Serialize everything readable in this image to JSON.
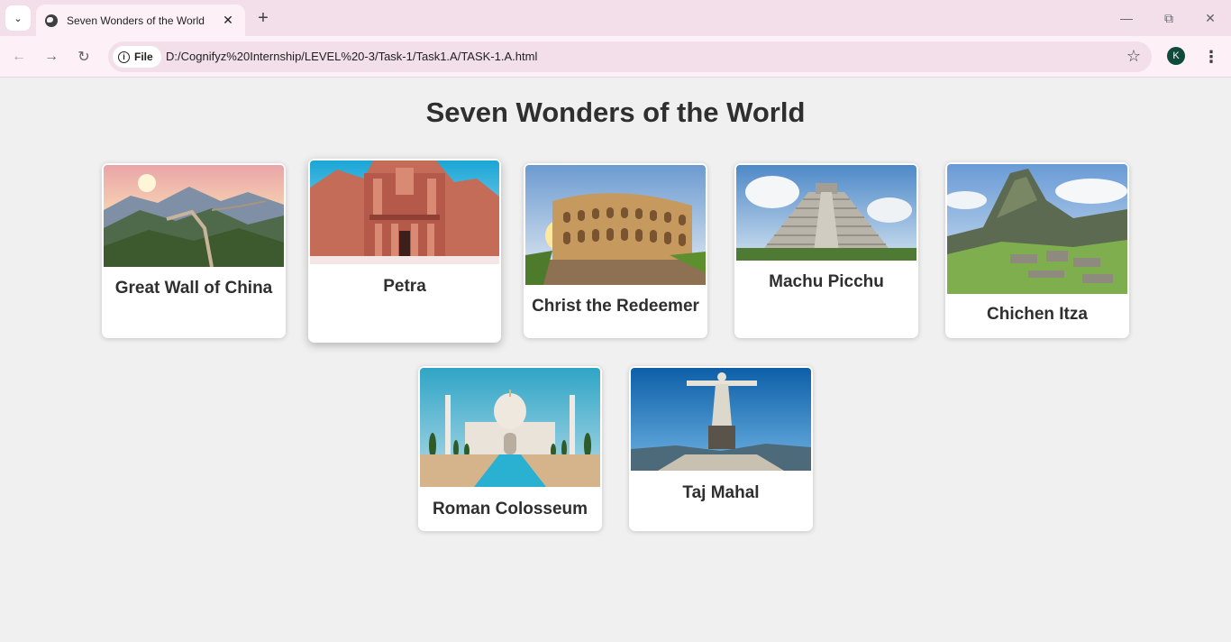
{
  "browser": {
    "tab_title": "Seven Wonders of the World",
    "chip_label": "File",
    "url": "D:/Cognifyz%20Internship/LEVEL%20-3/Task-1/Task1.A/TASK-1.A.html",
    "profile_initial": "K"
  },
  "page": {
    "title": "Seven Wonders of the World",
    "cards": [
      {
        "label": "Great Wall of China"
      },
      {
        "label": "Petra"
      },
      {
        "label": "Christ the Redeemer"
      },
      {
        "label": "Machu Picchu"
      },
      {
        "label": "Chichen Itza"
      },
      {
        "label": "Roman Colosseum"
      },
      {
        "label": "Taj Mahal"
      }
    ]
  }
}
